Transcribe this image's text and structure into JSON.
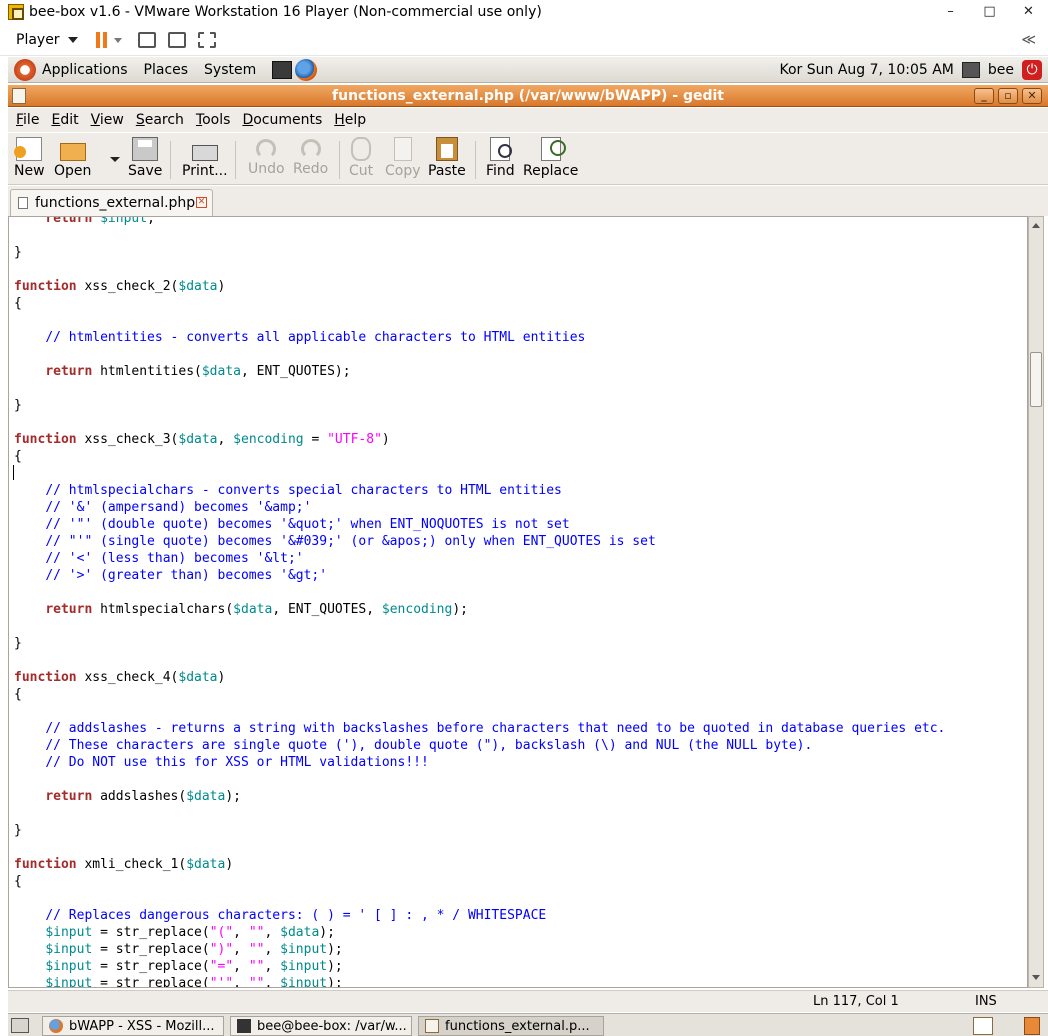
{
  "vm": {
    "title": "bee-box v1.6 - VMware Workstation 16 Player (Non-commercial use only)",
    "minimize": "–",
    "maximize": "□",
    "close": "✕",
    "player_label": "Player",
    "collapse": "≪"
  },
  "panel": {
    "menus": [
      "Applications",
      "Places",
      "System"
    ],
    "clock": "Kor  Sun Aug  7, 10:05 AM",
    "user": "bee",
    "power_glyph": "⏻"
  },
  "gedit": {
    "title": "functions_external.php (/var/www/bWAPP) - gedit",
    "window_controls": [
      "_",
      "▫",
      "✕"
    ],
    "menus": [
      "File",
      "Edit",
      "View",
      "Search",
      "Tools",
      "Documents",
      "Help"
    ],
    "toolbar": {
      "new": "New",
      "open": "Open",
      "save": "Save",
      "print": "Print...",
      "undo": "Undo",
      "redo": "Redo",
      "cut": "Cut",
      "copy": "Copy",
      "paste": "Paste",
      "find": "Find",
      "replace": "Replace"
    },
    "tab": {
      "label": "functions_external.php",
      "close_glyph": "✕"
    },
    "status": {
      "position": "Ln 117, Col 1",
      "mode": "INS"
    }
  },
  "code_lines": [
    [
      {
        "t": "    "
      },
      {
        "t": "return",
        "c": "k"
      },
      {
        "t": " "
      },
      {
        "t": "$input",
        "c": "v"
      },
      {
        "t": ";"
      }
    ],
    [
      {
        "t": ""
      }
    ],
    [
      {
        "t": "}"
      }
    ],
    [
      {
        "t": ""
      }
    ],
    [
      {
        "t": "function",
        "c": "k"
      },
      {
        "t": " xss_check_2("
      },
      {
        "t": "$data",
        "c": "v"
      },
      {
        "t": ")"
      }
    ],
    [
      {
        "t": "{"
      }
    ],
    [
      {
        "t": ""
      }
    ],
    [
      {
        "t": "    "
      },
      {
        "t": "// htmlentities - converts all applicable characters to HTML entities",
        "c": "c"
      }
    ],
    [
      {
        "t": ""
      }
    ],
    [
      {
        "t": "    "
      },
      {
        "t": "return",
        "c": "k"
      },
      {
        "t": " htmlentities("
      },
      {
        "t": "$data",
        "c": "v"
      },
      {
        "t": ", ENT_QUOTES);"
      }
    ],
    [
      {
        "t": ""
      }
    ],
    [
      {
        "t": "}"
      }
    ],
    [
      {
        "t": ""
      }
    ],
    [
      {
        "t": "function",
        "c": "k"
      },
      {
        "t": " xss_check_3("
      },
      {
        "t": "$data",
        "c": "v"
      },
      {
        "t": ", "
      },
      {
        "t": "$encoding",
        "c": "v"
      },
      {
        "t": " = "
      },
      {
        "t": "\"UTF-8\"",
        "c": "s"
      },
      {
        "t": ")"
      }
    ],
    [
      {
        "t": "{"
      }
    ],
    [
      {
        "t": ""
      }
    ],
    [
      {
        "t": "    "
      },
      {
        "t": "// htmlspecialchars - converts special characters to HTML entities",
        "c": "c"
      }
    ],
    [
      {
        "t": "    "
      },
      {
        "t": "// '&' (ampersand) becomes '&amp;'",
        "c": "c"
      }
    ],
    [
      {
        "t": "    "
      },
      {
        "t": "// '\"' (double quote) becomes '&quot;' when ENT_NOQUOTES is not set",
        "c": "c"
      }
    ],
    [
      {
        "t": "    "
      },
      {
        "t": "// \"'\" (single quote) becomes '&#039;' (or &apos;) only when ENT_QUOTES is set",
        "c": "c"
      }
    ],
    [
      {
        "t": "    "
      },
      {
        "t": "// '<' (less than) becomes '&lt;'",
        "c": "c"
      }
    ],
    [
      {
        "t": "    "
      },
      {
        "t": "// '>' (greater than) becomes '&gt;'",
        "c": "c"
      }
    ],
    [
      {
        "t": ""
      }
    ],
    [
      {
        "t": "    "
      },
      {
        "t": "return",
        "c": "k"
      },
      {
        "t": " htmlspecialchars("
      },
      {
        "t": "$data",
        "c": "v"
      },
      {
        "t": ", ENT_QUOTES, "
      },
      {
        "t": "$encoding",
        "c": "v"
      },
      {
        "t": ");"
      }
    ],
    [
      {
        "t": ""
      }
    ],
    [
      {
        "t": "}"
      }
    ],
    [
      {
        "t": ""
      }
    ],
    [
      {
        "t": "function",
        "c": "k"
      },
      {
        "t": " xss_check_4("
      },
      {
        "t": "$data",
        "c": "v"
      },
      {
        "t": ")"
      }
    ],
    [
      {
        "t": "{"
      }
    ],
    [
      {
        "t": ""
      }
    ],
    [
      {
        "t": "    "
      },
      {
        "t": "// addslashes - returns a string with backslashes before characters that need to be quoted in database queries etc.",
        "c": "c"
      }
    ],
    [
      {
        "t": "    "
      },
      {
        "t": "// These characters are single quote ('), double quote (\"), backslash (\\) and NUL (the NULL byte).",
        "c": "c"
      }
    ],
    [
      {
        "t": "    "
      },
      {
        "t": "// Do NOT use this for XSS or HTML validations!!!",
        "c": "c"
      }
    ],
    [
      {
        "t": ""
      }
    ],
    [
      {
        "t": "    "
      },
      {
        "t": "return",
        "c": "k"
      },
      {
        "t": " addslashes("
      },
      {
        "t": "$data",
        "c": "v"
      },
      {
        "t": ");"
      }
    ],
    [
      {
        "t": ""
      }
    ],
    [
      {
        "t": "}"
      }
    ],
    [
      {
        "t": ""
      }
    ],
    [
      {
        "t": "function",
        "c": "k"
      },
      {
        "t": " xmli_check_1("
      },
      {
        "t": "$data",
        "c": "v"
      },
      {
        "t": ")"
      }
    ],
    [
      {
        "t": "{"
      }
    ],
    [
      {
        "t": ""
      }
    ],
    [
      {
        "t": "    "
      },
      {
        "t": "// Replaces dangerous characters: ( ) = ' [ ] : , * / WHITESPACE",
        "c": "c"
      }
    ],
    [
      {
        "t": "    "
      },
      {
        "t": "$input",
        "c": "v"
      },
      {
        "t": " = str_replace("
      },
      {
        "t": "\"(\"",
        "c": "s"
      },
      {
        "t": ", "
      },
      {
        "t": "\"\"",
        "c": "s"
      },
      {
        "t": ", "
      },
      {
        "t": "$data",
        "c": "v"
      },
      {
        "t": ");"
      }
    ],
    [
      {
        "t": "    "
      },
      {
        "t": "$input",
        "c": "v"
      },
      {
        "t": " = str_replace("
      },
      {
        "t": "\")\"",
        "c": "s"
      },
      {
        "t": ", "
      },
      {
        "t": "\"\"",
        "c": "s"
      },
      {
        "t": ", "
      },
      {
        "t": "$input",
        "c": "v"
      },
      {
        "t": ");"
      }
    ],
    [
      {
        "t": "    "
      },
      {
        "t": "$input",
        "c": "v"
      },
      {
        "t": " = str_replace("
      },
      {
        "t": "\"=\"",
        "c": "s"
      },
      {
        "t": ", "
      },
      {
        "t": "\"\"",
        "c": "s"
      },
      {
        "t": ", "
      },
      {
        "t": "$input",
        "c": "v"
      },
      {
        "t": ");"
      }
    ],
    [
      {
        "t": "    "
      },
      {
        "t": "$input",
        "c": "v"
      },
      {
        "t": " = str_replace("
      },
      {
        "t": "\"'\"",
        "c": "s"
      },
      {
        "t": ", "
      },
      {
        "t": "\"\"",
        "c": "s"
      },
      {
        "t": ", "
      },
      {
        "t": "$input",
        "c": "v"
      },
      {
        "t": ");"
      }
    ]
  ],
  "taskbar": {
    "tasks": [
      "bWAPP - XSS - Mozill...",
      "bee@bee-box: /var/w...",
      "functions_external.p..."
    ]
  },
  "colors": {
    "keyword": "#a52a2a",
    "comment": "#0000ff",
    "variable": "#008a8c",
    "string": "#ff00ff",
    "title_orange": "#d9782c"
  }
}
